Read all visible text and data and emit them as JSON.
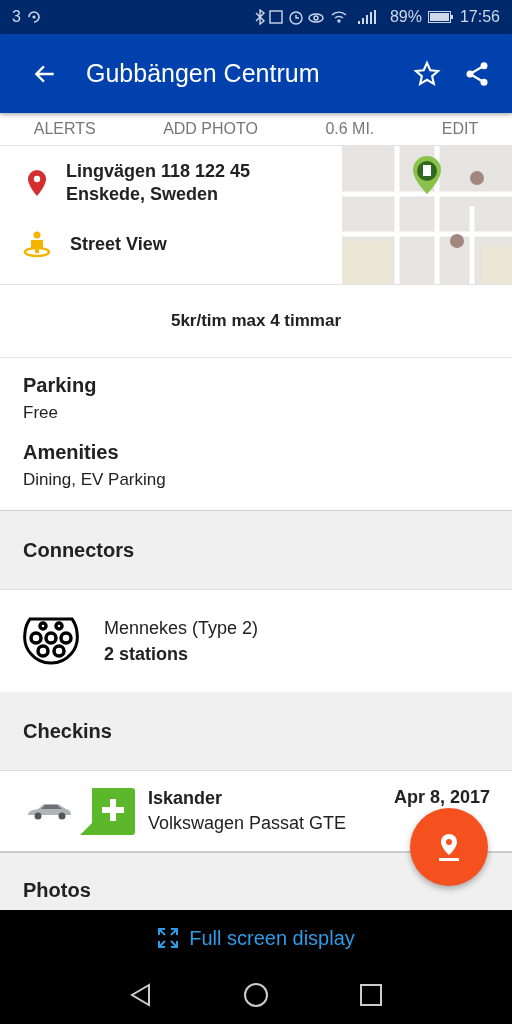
{
  "status_bar": {
    "carrier": "3",
    "battery": "89%",
    "time": "17:56"
  },
  "app_bar": {
    "title": "Gubbängen Centrum",
    "favorite": false
  },
  "actions": [
    "ALERTS",
    "ADD PHOTO",
    "0.6 MI.",
    "EDIT"
  ],
  "location": {
    "address_line_1": "Lingvägen 118 122 45",
    "address_line_2": "Enskede, Sweden",
    "street_view": "Street View"
  },
  "pricing": "5kr/tim max 4 timmar",
  "details": [
    {
      "label": "Parking",
      "value": "Free"
    },
    {
      "label": "Amenities",
      "value": "Dining, EV Parking"
    }
  ],
  "connectors": {
    "heading": "Connectors",
    "items": [
      {
        "name": "Mennekes (Type 2)",
        "count": "2 stations"
      }
    ]
  },
  "checkins": {
    "heading": "Checkins",
    "items": [
      {
        "user": "Iskander",
        "vehicle": "Volkswagen Passat GTE",
        "date": "Apr 8, 2017"
      }
    ]
  },
  "photos": {
    "heading": "Photos"
  },
  "full_screen": "Full screen display"
}
